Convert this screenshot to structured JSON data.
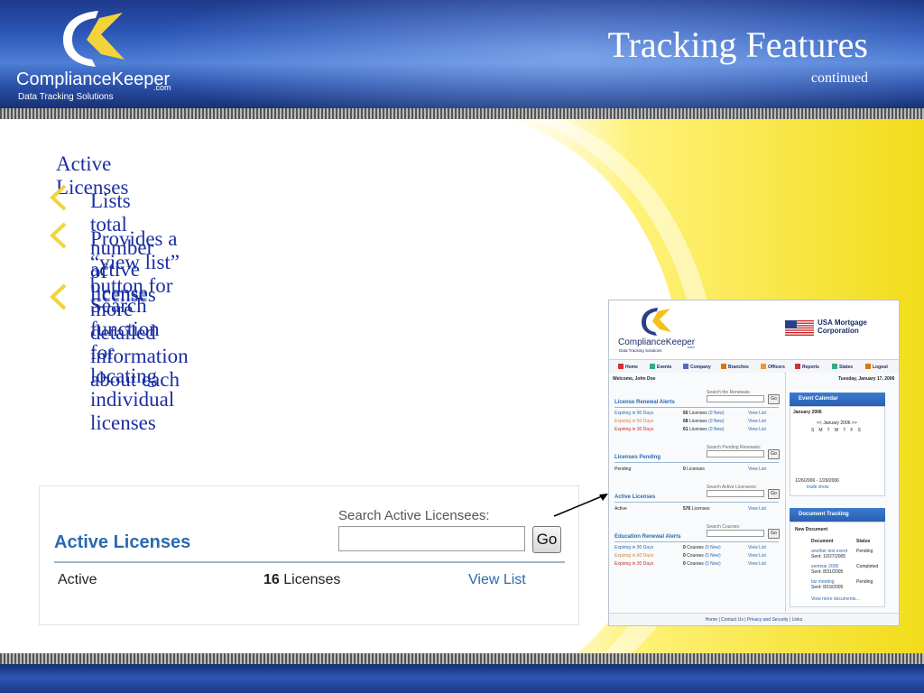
{
  "header": {
    "logo_name": "ComplianceKeeper",
    "logo_suffix": ".com",
    "logo_tagline": "Data Tracking Solutions",
    "title": "Tracking Features",
    "subtitle": "continued"
  },
  "content": {
    "heading": "Active Licenses",
    "bullets": [
      "Lists total number of licenses",
      "Provides a “view list” button for more detailed information about each",
      "active license",
      "Search function for locating individual licenses"
    ]
  },
  "zoom": {
    "search_label": "Search Active Licensees:",
    "go_label": "Go",
    "section_title": "Active Licenses",
    "row_status": "Active",
    "row_count": "16",
    "row_unit": "Licenses",
    "row_link": "View List"
  },
  "mini": {
    "logo_name": "ComplianceKeeper",
    "logo_suffix": ".com",
    "logo_tagline": "Data Tracking Solutions",
    "company": "USA Mortgage",
    "company2": "Corporation",
    "nav": [
      "Home",
      "Events",
      "Company",
      "Branches",
      "Officers",
      "Reports",
      "States",
      "Logout"
    ],
    "welcome": "Welcome, John Doe",
    "date": "Tuesday, January 17, 2006",
    "renewal": {
      "search_label": "Search the Renewals:",
      "title": "License Renewal Alerts",
      "rows": [
        {
          "label": "Expiring in 90 Days",
          "count": "60",
          "unit": "Licenses",
          "new": "(0 New)",
          "link": "View List"
        },
        {
          "label": "Expiring in 60 Days",
          "count": "68",
          "unit": "Licenses",
          "new": "(0 New)",
          "link": "View List"
        },
        {
          "label": "Expiring in 30 Days",
          "count": "61",
          "unit": "Licenses",
          "new": "(0 New)",
          "link": "View List"
        }
      ]
    },
    "pending": {
      "search_label": "Search Pending Renewals:",
      "title": "Licenses Pending",
      "label": "Pending",
      "count": "0",
      "unit": "Licenses",
      "link": "View List"
    },
    "active": {
      "search_label": "Search Active Licensees:",
      "title": "Active Licenses",
      "label": "Active",
      "count": "576",
      "unit": "Licenses",
      "link": "View List"
    },
    "education": {
      "search_label": "Search Courses:",
      "title": "Education Renewal Alerts",
      "rows": [
        {
          "label": "Expiring in 90 Days",
          "count": "0",
          "unit": "Courses",
          "new": "(0 New)",
          "link": "View List"
        },
        {
          "label": "Expiring in 60 Days",
          "count": "0",
          "unit": "Courses",
          "new": "(0 New)",
          "link": "View List"
        },
        {
          "label": "Expiring in 30 Days",
          "count": "0",
          "unit": "Courses",
          "new": "(0 New)",
          "link": "View List"
        }
      ]
    },
    "go": "Go",
    "event_calendar": "Event Calendar",
    "cal_month": "January 2006",
    "cal_nav": "<< January 2006 >>",
    "cal_days": [
      "S",
      "M",
      "T",
      "W",
      "T",
      "F",
      "S"
    ],
    "cal_range": "1/26/2006 - 1/29/2006",
    "cal_show": "trade show",
    "doc_tracking": "Document Tracking",
    "new_doc": "New Document",
    "doc_head": [
      "Document",
      "Status"
    ],
    "docs": [
      {
        "name": "another test event",
        "sent": "Sent: 10/27/2005",
        "status": "Pending"
      },
      {
        "name": "seminar 2005",
        "sent": "Sent: 8/31/2005",
        "status": "Completed"
      },
      {
        "name": "biz meeting",
        "sent": "Sent: 8/19/2005",
        "status": "Pending"
      }
    ],
    "view_more": "View more documents...",
    "footer": "Home  |  Contact Us  |  Privacy and Security  |  Links"
  }
}
